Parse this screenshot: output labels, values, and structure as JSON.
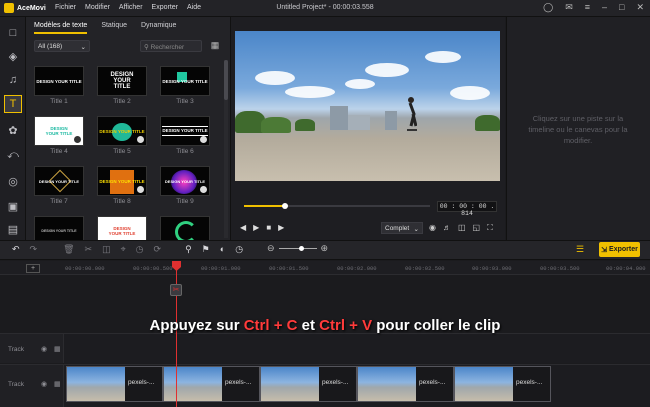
{
  "app": {
    "name": "AceMovi",
    "window_title": "Untitled Project* - 00:00:03.558"
  },
  "menu": [
    "Fichier",
    "Modifier",
    "Afficher",
    "Exporter",
    "Aide"
  ],
  "sidebar_icons": [
    "media-icon",
    "layers-icon",
    "audio-icon",
    "text-icon",
    "filter-icon",
    "transition-icon",
    "element-icon",
    "sticker-icon",
    "template-icon"
  ],
  "library": {
    "tabs": [
      "Modèles de texte",
      "Statique",
      "Dynamique"
    ],
    "active_tab": 0,
    "filter_value": "All (168)",
    "search_placeholder": "Rechercher",
    "items": [
      {
        "label": "Title 1",
        "preview": "DESIGN YOUR TITLE"
      },
      {
        "label": "Title 2",
        "preview": "DESIGN YOUR TITLE"
      },
      {
        "label": "Title 3",
        "preview": "DESIGN YOUR TITLE"
      },
      {
        "label": "Title 4",
        "preview": "DESIGN YOUR TITLE"
      },
      {
        "label": "Title 5",
        "preview": "DESIGN YOUR TITLE"
      },
      {
        "label": "Title 6",
        "preview": "DESIGN YOUR TITLE"
      },
      {
        "label": "Title 7",
        "preview": "DESIGN YOUR TITLE"
      },
      {
        "label": "Title 8",
        "preview": "DESIGN YOUR TITLE"
      },
      {
        "label": "Title 9",
        "preview": "DESIGN YOUR TITLE"
      },
      {
        "label": "",
        "preview": "DESIGN YOUR TITLE"
      },
      {
        "label": "",
        "preview": "DESIGN YOUR TITLE"
      },
      {
        "label": "",
        "preview": ""
      }
    ]
  },
  "player": {
    "timecode": "00 : 00 : 00 . 814",
    "progress": 0.22,
    "quality": "Complet"
  },
  "properties": {
    "hint": "Cliquez sur une piste sur la timeline ou le canevas pour la modifier."
  },
  "toolbar": {
    "export_label": "Exporter",
    "zoom_level": 0.6
  },
  "ruler": [
    "00:00:00.000",
    "00:00:00.500",
    "00:00:01.000",
    "00:00:01.500",
    "00:00:02.000",
    "00:00:02.500",
    "00:00:03.000",
    "00:00:03.500",
    "00:00:04.000"
  ],
  "tracks": [
    {
      "label": "Track"
    },
    {
      "label": "Track"
    }
  ],
  "clips": [
    {
      "name": "pexels-..."
    },
    {
      "name": "pexels-..."
    },
    {
      "name": "pexels-..."
    },
    {
      "name": "pexels-..."
    },
    {
      "name": "pexels-..."
    }
  ],
  "overlay": {
    "part1": "Appuyez sur ",
    "shortcut1": "Ctrl + C",
    "part2": " et ",
    "shortcut2": "Ctrl + V",
    "part3": " pour coller le clip"
  },
  "colors": {
    "accent": "#f0c000",
    "playhead": "#e03030",
    "background": "#1b1b1e"
  }
}
